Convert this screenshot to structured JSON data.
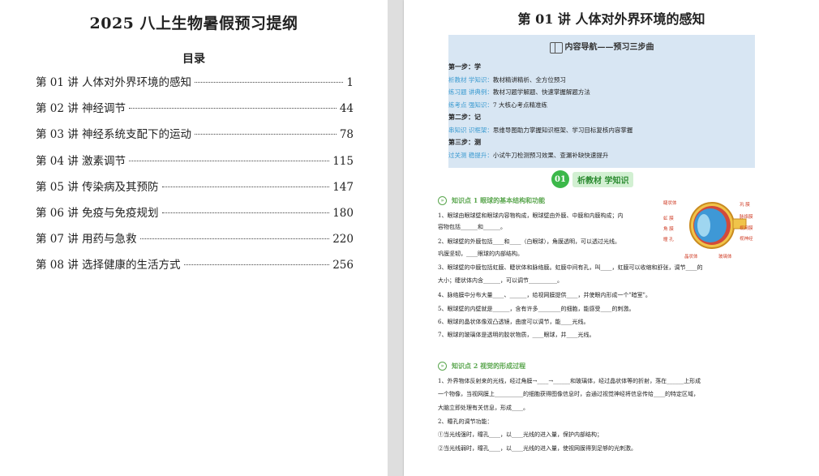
{
  "left": {
    "title": "2025 八上生物暑假预习提纲",
    "toc_heading": "目录",
    "toc": [
      {
        "label": "第 01 讲 人体对外界环境的感知",
        "page": "1"
      },
      {
        "label": "第 02 讲 神经调节",
        "page": "44"
      },
      {
        "label": "第 03 讲 神经系统支配下的运动",
        "page": "78"
      },
      {
        "label": "第 04 讲 激素调节",
        "page": "115"
      },
      {
        "label": "第 05 讲 传染病及其预防",
        "page": "147"
      },
      {
        "label": "第 06 讲 免疫与免疫规划",
        "page": "180"
      },
      {
        "label": "第 07 讲 用药与急救",
        "page": "220"
      },
      {
        "label": "第 08 讲 选择健康的生活方式",
        "page": "256"
      }
    ]
  },
  "right": {
    "title": "第 01 讲  人体对外界环境的感知",
    "nav_heading": "内容导航——预习三步曲",
    "step1": "第一步：学",
    "step1_lines": [
      {
        "tag": "析教材  学知识：",
        "text": "教材精讲精析、全方位预习"
      },
      {
        "tag": "练习题  讲典例：",
        "text": "教材习题学解题、快速掌握解题方法"
      },
      {
        "tag": "练考点  强知识：",
        "text": "7 大核心考点精准练"
      }
    ],
    "step2": "第二步：记",
    "step2_lines": [
      {
        "tag": "串知识  识框架：",
        "text": "思维导图助力掌握知识框架、学习目标复核内容掌握"
      }
    ],
    "step3": "第三步：测",
    "step3_lines": [
      {
        "tag": "过关测  稳提升：",
        "text": "小试牛刀检测预习效果、查漏补缺快速提升"
      }
    ],
    "section_num": "01",
    "section_label": "析教材 学知识",
    "kp1": "知识点 1  眼球的基本结构和功能",
    "kp1_items": [
      "1、眼球由眼球壁和眼球内容物构成，眼球壁由外膜、中膜和内膜构成；内",
      "    容物包括______和______。",
      "2、眼球壁的外膜包括____和____（白眼球），角膜透明，可以透过光线。",
      "    巩膜坚韧，____眼球的内部结构。",
      "3、眼球壁的中膜包括虹膜、睫状体和脉络膜。虹膜中间有孔，叫____，虹膜可以收缩和舒张，调节____的",
      "    大小；睫状体内含______，可以调节__________。",
      "4、脉络膜中分布大量____、______，给视网膜提供____，并使眼内形成一个\"暗室\"。",
      "5、眼球壁的内壁就是______，含有许多________的细胞，能感受____的刺激。",
      "6、眼球的晶状体像双凸透镜，曲度可以调节，能____光线。",
      "7、眼球的玻璃体是透明的胶状物质，____眼球，并____光线。"
    ],
    "eye_labels": {
      "l1": "睫状体",
      "l2": "虹  膜",
      "l3": "角  膜",
      "l4": "瞳  孔",
      "r1": "巩  膜",
      "r2": "脉络膜",
      "r3": "视网膜",
      "r4": "视神经",
      "b1": "晶状体",
      "b2": "玻璃体"
    },
    "kp2": "知识点 2   视觉的形成过程",
    "kp2_items": [
      "1、外界物体反射来的光线，经过角膜→____→______和玻璃体，经过晶状体等的折射，落在______上形成",
      "    一个物像，当视网膜上__________的细胞获得图像信息时，会通过视觉神经将信息传给____的特定区域，",
      "    大脑立即处理有关信息，形成____。",
      "2、瞳孔的调节功能：",
      "①当光线强时，瞳孔____，以____光线的进入量，保护内部结构；",
      "②当光线弱时，瞳孔____，以____光线的进入量，使视网膜得到足够的光刺激。"
    ]
  },
  "colors": {
    "accent": "#3a9ad0",
    "green": "#3cb84a",
    "nav_bg": "#d8e6f3"
  }
}
